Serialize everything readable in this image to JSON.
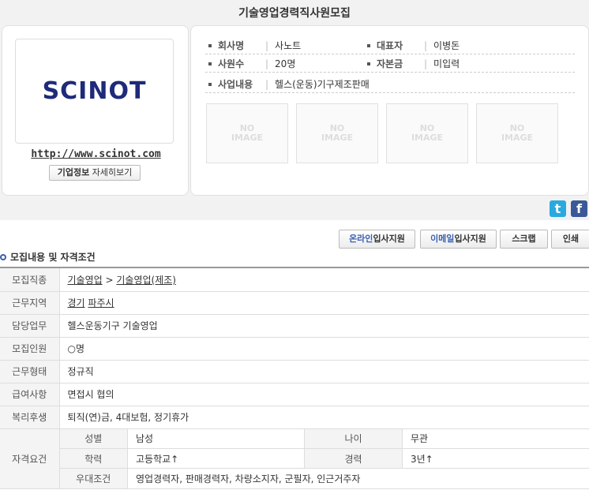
{
  "page_title": "기술영업경력직사원모집",
  "company": {
    "logo_text": "SCINOT",
    "website": "http://www.scinot.com",
    "detail_button": {
      "bold": "기업정보",
      "rest": " 자세히보기"
    },
    "info": {
      "name_label": "회사명",
      "name_value": "사노트",
      "ceo_label": "대표자",
      "ceo_value": "이병돈",
      "employees_label": "사원수",
      "employees_value": "20명",
      "capital_label": "자본금",
      "capital_value": "미입력",
      "business_label": "사업내용",
      "business_value": "헬스(운동)기구제조판매"
    },
    "no_image": [
      "NO\nIMAGE",
      "NO\nIMAGE",
      "NO\nIMAGE",
      "NO\nIMAGE"
    ]
  },
  "social": {
    "twitter_icon": "t",
    "facebook_icon": "f"
  },
  "actions": {
    "online_accent": "온라인",
    "online_rest": "입사지원",
    "email_accent": "이메일",
    "email_rest": "입사지원",
    "scrap": "스크랩",
    "print": "인쇄"
  },
  "section_title": "모집내용 및 자격조건",
  "details": {
    "job_type_label": "모집직종",
    "job_type_1": "기술영업",
    "job_type_sep": " > ",
    "job_type_2": "기술영업(제조)",
    "location_label": "근무지역",
    "location_1": "경기",
    "location_2": "파주시",
    "duty_label": "담당업무",
    "duty_value": "헬스운동기구 기술영업",
    "headcount_label": "모집인원",
    "headcount_value": "○명",
    "work_type_label": "근무형태",
    "work_type_value": "정규직",
    "salary_label": "급여사항",
    "salary_value": "면접시 협의",
    "welfare_label": "복리후생",
    "welfare_value": "퇴직(연)금, 4대보험, 정기휴가",
    "qualification_label": "자격요건",
    "gender_label": "성별",
    "gender_value": "남성",
    "age_label": "나이",
    "age_value": "무관",
    "education_label": "학력",
    "education_value": "고등학교↑",
    "experience_label": "경력",
    "experience_value": "3년↑",
    "preference_label": "우대조건",
    "preference_value": "영업경력자, 판매경력자, 차량소지자, 군필자, 인근거주자"
  }
}
